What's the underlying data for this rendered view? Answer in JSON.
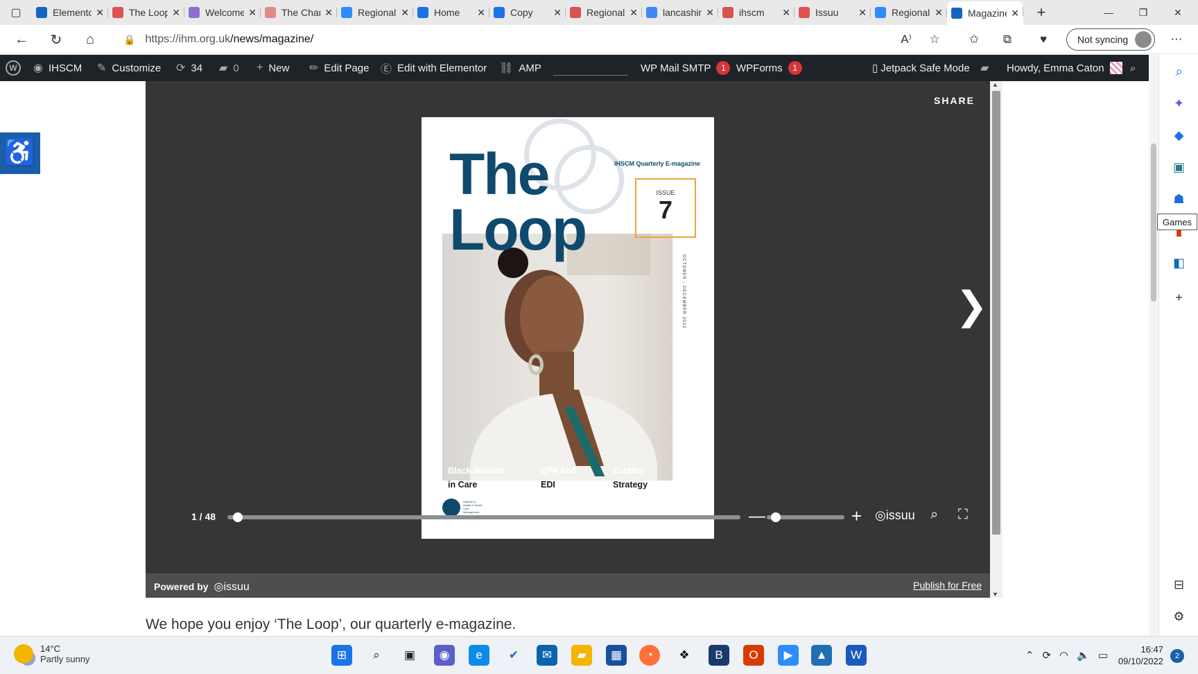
{
  "browser": {
    "tabs": [
      {
        "title": "Elementor",
        "favicon": "elementor-icon",
        "color": "#1565c0"
      },
      {
        "title": "The Loop",
        "favicon": "issuu-icon",
        "color": "#e05252"
      },
      {
        "title": "Welcome",
        "favicon": "swirl-icon",
        "color": "#8e6fd0"
      },
      {
        "title": "The Chart",
        "favicon": "issuu-icon",
        "color": "#e08a8a"
      },
      {
        "title": "Regional",
        "favicon": "zoom-icon",
        "color": "#2d8cff"
      },
      {
        "title": "Home",
        "favicon": "c-logo-icon",
        "color": "#1a73e8"
      },
      {
        "title": "Copy",
        "favicon": "c-logo-icon",
        "color": "#1a73e8"
      },
      {
        "title": "Regional",
        "favicon": "pdf-icon",
        "color": "#d9534f"
      },
      {
        "title": "lancashire",
        "favicon": "google-icon",
        "color": "#4285f4"
      },
      {
        "title": "ihscm",
        "favicon": "pdf-icon",
        "color": "#d9534f"
      },
      {
        "title": "Issuu",
        "favicon": "issuu-icon",
        "color": "#e05252"
      },
      {
        "title": "Regional",
        "favicon": "zoom-icon",
        "color": "#2d8cff"
      },
      {
        "title": "Magazine",
        "favicon": "elementor-icon",
        "color": "#1565c0",
        "active": true
      }
    ],
    "new_tab": "+",
    "url_host": "https://ihm.org.uk",
    "url_path": "/news/magazine/",
    "sync_label": "Not syncing"
  },
  "wpbar": {
    "site": "IHSCM",
    "customize": "Customize",
    "updates": "34",
    "comments": "0",
    "new": "New",
    "edit_page": "Edit Page",
    "elementor": "Edit with Elementor",
    "amp": "AMP",
    "smtp": "WP Mail SMTP",
    "smtp_count": "1",
    "wpforms": "WPForms",
    "wpforms_count": "1",
    "jetpack": "Jetpack Safe Mode",
    "howdy": "Howdy, Emma Caton"
  },
  "viewer": {
    "share": "SHARE",
    "page_indicator": "1 / 48",
    "progress_fraction": 0.02,
    "zoom_fraction": 0.12,
    "issuu_brand": "issuu",
    "powered_by": "Powered by",
    "publish_free": "Publish for Free"
  },
  "cover": {
    "title_line1": "The",
    "title_line2": "Loop",
    "magazine_label": "IHSCM Quarterly E-magazine",
    "issue_label": "ISSUE",
    "issue_number": "7",
    "vertical_text": "OCTOBER - DECEMBER 2022",
    "captions": [
      {
        "line1": "Black Women",
        "line2": "in Care"
      },
      {
        "line1": "EPR and",
        "line2": "EDI"
      },
      {
        "line1": "Estates",
        "line2": "Strategy"
      }
    ],
    "logo_text": "Institute of Health & Social Care Management"
  },
  "page": {
    "intro": "We hope you enjoy ‘The Loop’, our quarterly e-magazine."
  },
  "sidebar": {
    "tooltip": "Games"
  },
  "taskbar": {
    "temperature": "14°C",
    "condition": "Partly sunny",
    "time": "16:47",
    "date": "09/10/2022",
    "notification_count": "2"
  }
}
